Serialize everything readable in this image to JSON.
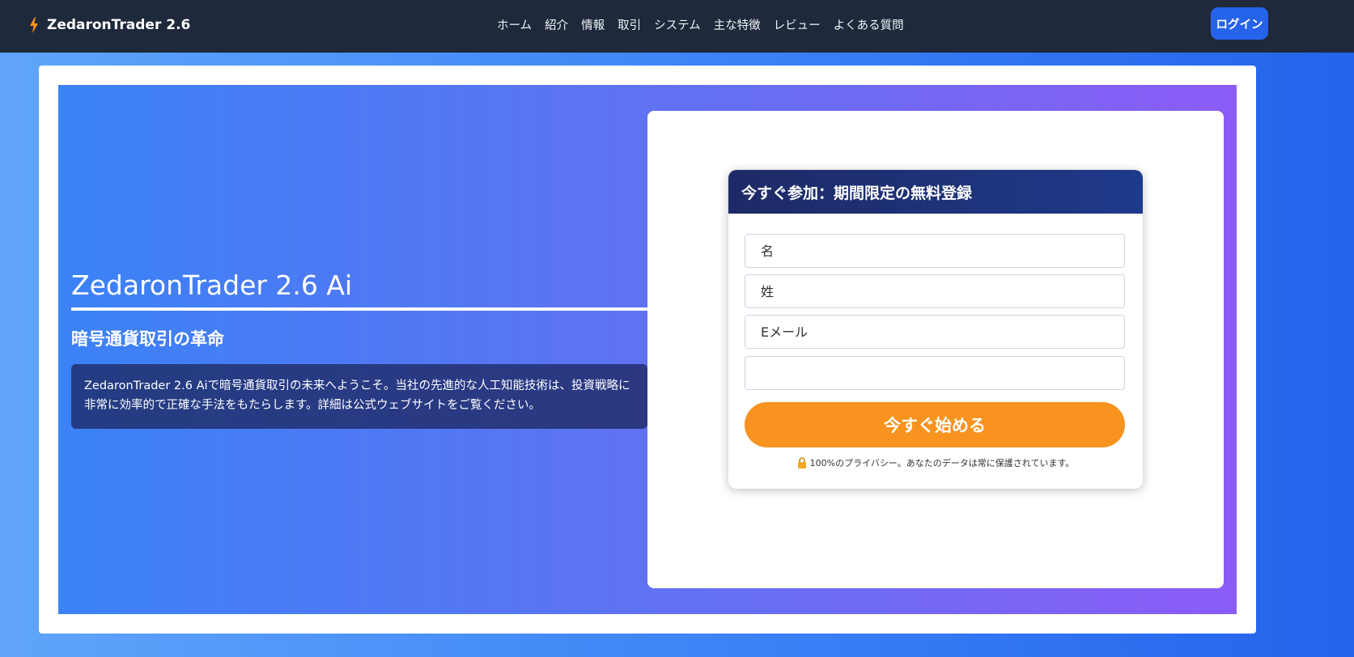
{
  "brand": {
    "name": "ZedaronTrader 2.6"
  },
  "nav": {
    "items": [
      "ホーム",
      "紹介",
      "情報",
      "取引",
      "システム",
      "主な特徴",
      "レビュー",
      "よくある質問"
    ],
    "login_label": "ログイン"
  },
  "hero": {
    "title": "ZedaronTrader 2.6 Ai",
    "subtitle": "暗号通貨取引の革命",
    "description": "ZedaronTrader 2.6 Aiで暗号通貨取引の未来へようこそ。当社の先進的な人工知能技術は、投資戦略に非常に効率的で正確な手法をもたらします。詳細は公式ウェブサイトをご覧ください。"
  },
  "form": {
    "header": "今すぐ参加：期間限定の無料登録",
    "first_name_placeholder": "名",
    "last_name_placeholder": "姓",
    "email_placeholder": "Eメール",
    "phone_value": "",
    "submit_label": "今すぐ始める",
    "privacy_text": "100%のプライバシー。あなたのデータは常に保護されています。"
  },
  "colors": {
    "navbar": "#1e293b",
    "accent": "#2563eb",
    "cta": "#f7931e",
    "form_header": "#1e2a66"
  }
}
